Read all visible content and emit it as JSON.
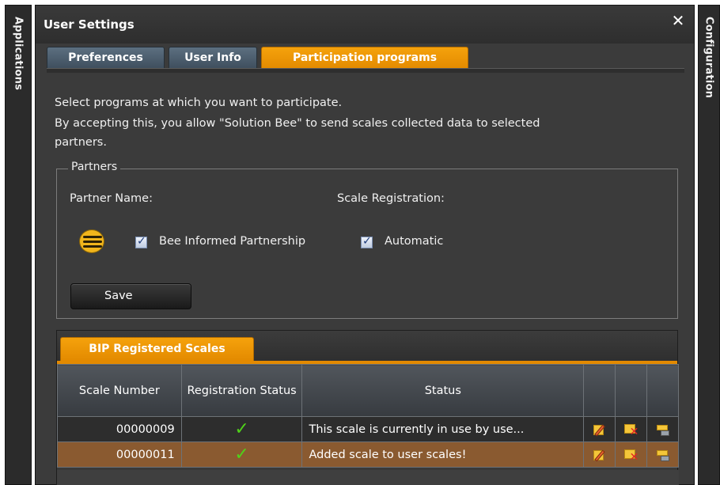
{
  "side_left": {
    "label": "Applications"
  },
  "side_right": {
    "label": "Configuration"
  },
  "window": {
    "title": "User Settings",
    "close_glyph": "✕"
  },
  "tabs": [
    {
      "label": "Preferences",
      "active": false
    },
    {
      "label": "User Info",
      "active": false
    },
    {
      "label": "Participation programs",
      "active": true
    }
  ],
  "intro": {
    "line1": "Select programs at which you want to participate.",
    "line2": "By accepting this, you allow \"Solution Bee\" to send scales collected data to selected",
    "line3": "partners."
  },
  "partners": {
    "legend": "Partners",
    "partner_name_label": "Partner Name:",
    "scale_registration_label": "Scale Registration:",
    "partner": {
      "name": "Bee Informed Partnership",
      "checked": true,
      "icon": "bee-logo-icon"
    },
    "registration": {
      "label": "Automatic",
      "checked": true
    },
    "save_label": "Save"
  },
  "bip_panel": {
    "tab_label": "BIP Registered Scales",
    "columns": [
      "Scale Number",
      "Registration Status",
      "Status"
    ],
    "rows": [
      {
        "scale_number": "00000009",
        "registered": true,
        "status": "This scale is currently in use by use..."
      },
      {
        "scale_number": "00000011",
        "registered": true,
        "status": "Added scale to user scales!"
      }
    ],
    "action_icons": [
      "edit-icon",
      "delete-icon",
      "scale-icon"
    ]
  },
  "colors": {
    "accent_orange": "#e38a00",
    "selected_row": "#8a5a30",
    "check_green": "#4fd11a"
  }
}
